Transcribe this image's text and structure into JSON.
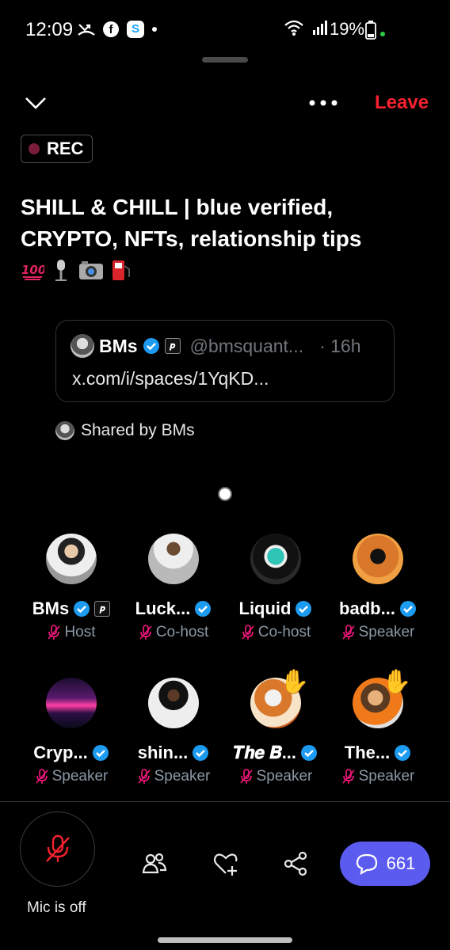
{
  "status_bar": {
    "time": "12:09",
    "battery": "19%"
  },
  "header": {
    "leave_label": "Leave",
    "rec_label": "REC"
  },
  "space": {
    "title": "SHILL & CHILL |  blue verified, CRYPTO, NFTs, relationship tips",
    "title_emojis": [
      "hundred-points-icon",
      "microphone-icon",
      "camera-icon",
      "fuel-pump-icon"
    ]
  },
  "tweet_card": {
    "name": "BMs",
    "handle": "@bmsquant...",
    "time_ago": "· 16h",
    "link": "x.com/i/spaces/1YqKD..."
  },
  "shared_by": "Shared by BMs",
  "participants": [
    {
      "name": "BMs",
      "role": "Host",
      "verified": true,
      "affiliate": true,
      "hand": false
    },
    {
      "name": "Luck...",
      "role": "Co-host",
      "verified": true,
      "affiliate": false,
      "hand": false
    },
    {
      "name": "Liquid",
      "role": "Co-host",
      "verified": true,
      "affiliate": false,
      "hand": false
    },
    {
      "name": "badb...",
      "role": "Speaker",
      "verified": true,
      "affiliate": false,
      "hand": false
    },
    {
      "name": "Cryp...",
      "role": "Speaker",
      "verified": true,
      "affiliate": false,
      "hand": false
    },
    {
      "name": "shin...",
      "role": "Speaker",
      "verified": true,
      "affiliate": false,
      "hand": false
    },
    {
      "name": "𝑻𝒉𝒆 𝑩...",
      "role": "Speaker",
      "verified": true,
      "affiliate": false,
      "hand": true
    },
    {
      "name": "The...",
      "role": "Speaker",
      "verified": true,
      "affiliate": false,
      "hand": true
    }
  ],
  "bottom_bar": {
    "mic_label": "Mic is off",
    "chat_count": "661"
  },
  "colors": {
    "leave": "#f4212e",
    "verified": "#1d9bf0",
    "mic_off": "#f91880",
    "chat_button": "#5b5bf0"
  }
}
